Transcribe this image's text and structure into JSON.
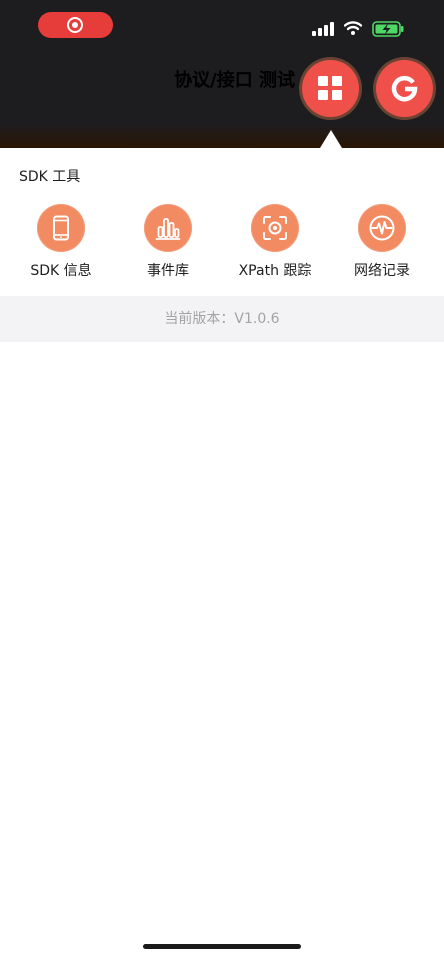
{
  "header": {
    "title": "协议/接口 测试"
  },
  "sdk_panel": {
    "section_title": "SDK 工具",
    "tools": [
      {
        "label": "SDK 信息",
        "icon": "phone-icon"
      },
      {
        "label": "事件库",
        "icon": "bar-chart-icon"
      },
      {
        "label": "XPath 跟踪",
        "icon": "focus-target-icon"
      },
      {
        "label": "网络记录",
        "icon": "pulse-icon"
      }
    ],
    "version_prefix": "当前版本：",
    "version_value": "V1.0.6"
  },
  "fabs": {
    "grid": "grid-icon",
    "g": "G"
  },
  "status_bar": {
    "battery_state": "charging"
  },
  "colors": {
    "accent": "#f0504a",
    "tool_icon_bg": "#f28a62",
    "record_pill": "#e63c3a",
    "dark_bg": "#1d1c1f"
  }
}
